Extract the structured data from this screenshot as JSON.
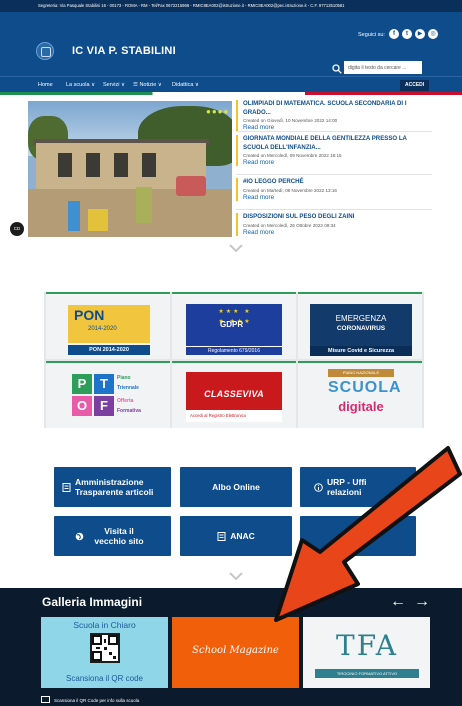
{
  "topbar": {
    "text": "Segreteria: Via Pasquale Stabilini 16 - 00173 - ROMA - RM - Tel/Fax 0672215968 - RMIC8EA002@istruzione.it - RMIC8EA002@pec.istruzione.it - C.F. 97712510581"
  },
  "header": {
    "title": "IC VIA P. STABILINI",
    "follow_label": "Seguici su:",
    "search_placeholder": "digita il testo da cercare ..."
  },
  "nav": {
    "items": [
      "Home",
      "La scuola ∨",
      "Servizi ∨",
      "☰ Notizie ∨",
      "Didattica ∨"
    ],
    "login_label": "ACCEDI"
  },
  "news": [
    {
      "title": "OLIMPIADI DI MATEMATICA. SCUOLA SECONDARIA DI I GRADO...",
      "date": "Created on Giovedì, 10 Novembre 2022 14:00",
      "more": "Read more"
    },
    {
      "title": "GIORNATA MONDIALE DELLA GENTILEZZA PRESSO LA SCUOLA DELL'INFANZIA...",
      "date": "Created on Mercoledì, 09 Novembre 2022 18:15",
      "more": "Read more"
    },
    {
      "title": "#IO LEGGO PERCHÉ",
      "date": "Created on Martedì, 08 Novembre 2022 13:16",
      "more": "Read more"
    },
    {
      "title": "DISPOSIZIONI SUL PESO DEGLI ZAINI",
      "date": "Created on Mercoledì, 26 Ottobre 2022 09:34",
      "more": "Read more"
    }
  ],
  "cd_badge": "CD",
  "banners": {
    "pon": {
      "word": "PON",
      "years": "2014-2020",
      "caption": "PON 2014-2020"
    },
    "gdpr": {
      "word": "GDPR",
      "caption": "Regolamento 679/2016"
    },
    "covid": {
      "line1": "EMERGENZA",
      "line2": "CORONAVIRUS",
      "caption": "Misure Covid e Sicurezza"
    },
    "ptof": {
      "letters": [
        "P",
        "T",
        "O",
        "F"
      ],
      "words": [
        "Piano",
        "Triennale",
        "Offerta",
        "Formativa"
      ]
    },
    "classeviva": {
      "word": "CLASSEVIVA",
      "strip": "Accedi al Registro Elettronico"
    },
    "scuola_digitale": {
      "top": "PIANO NAZIONALE",
      "word1": "SCUOLA",
      "word2": "digitale"
    }
  },
  "services": [
    {
      "label": "Amministrazione Trasparente articoli"
    },
    {
      "label": "Albo Online"
    },
    {
      "label": "URP - Uffi relazioni"
    },
    {
      "label": "Visita il vecchio sito"
    },
    {
      "label": "ANAC"
    }
  ],
  "gallery": {
    "title": "Galleria Immagini",
    "prev": "←",
    "next": "→",
    "card1": {
      "top": "Scuola in Chiaro",
      "bottom": "Scansiona il QR code"
    },
    "card2": {
      "text": "School Magazine"
    },
    "card3": {
      "logo": "TFA",
      "sub": "TIROCINIO FORMATIVO ATTIVO"
    },
    "caption": "Scansiona il QR Code per info sulla scuola"
  },
  "colors": {
    "primary": "#0e4c8c",
    "dark": "#0b2f5b",
    "accent": "#f2c230",
    "arrow": "#e8451a"
  }
}
